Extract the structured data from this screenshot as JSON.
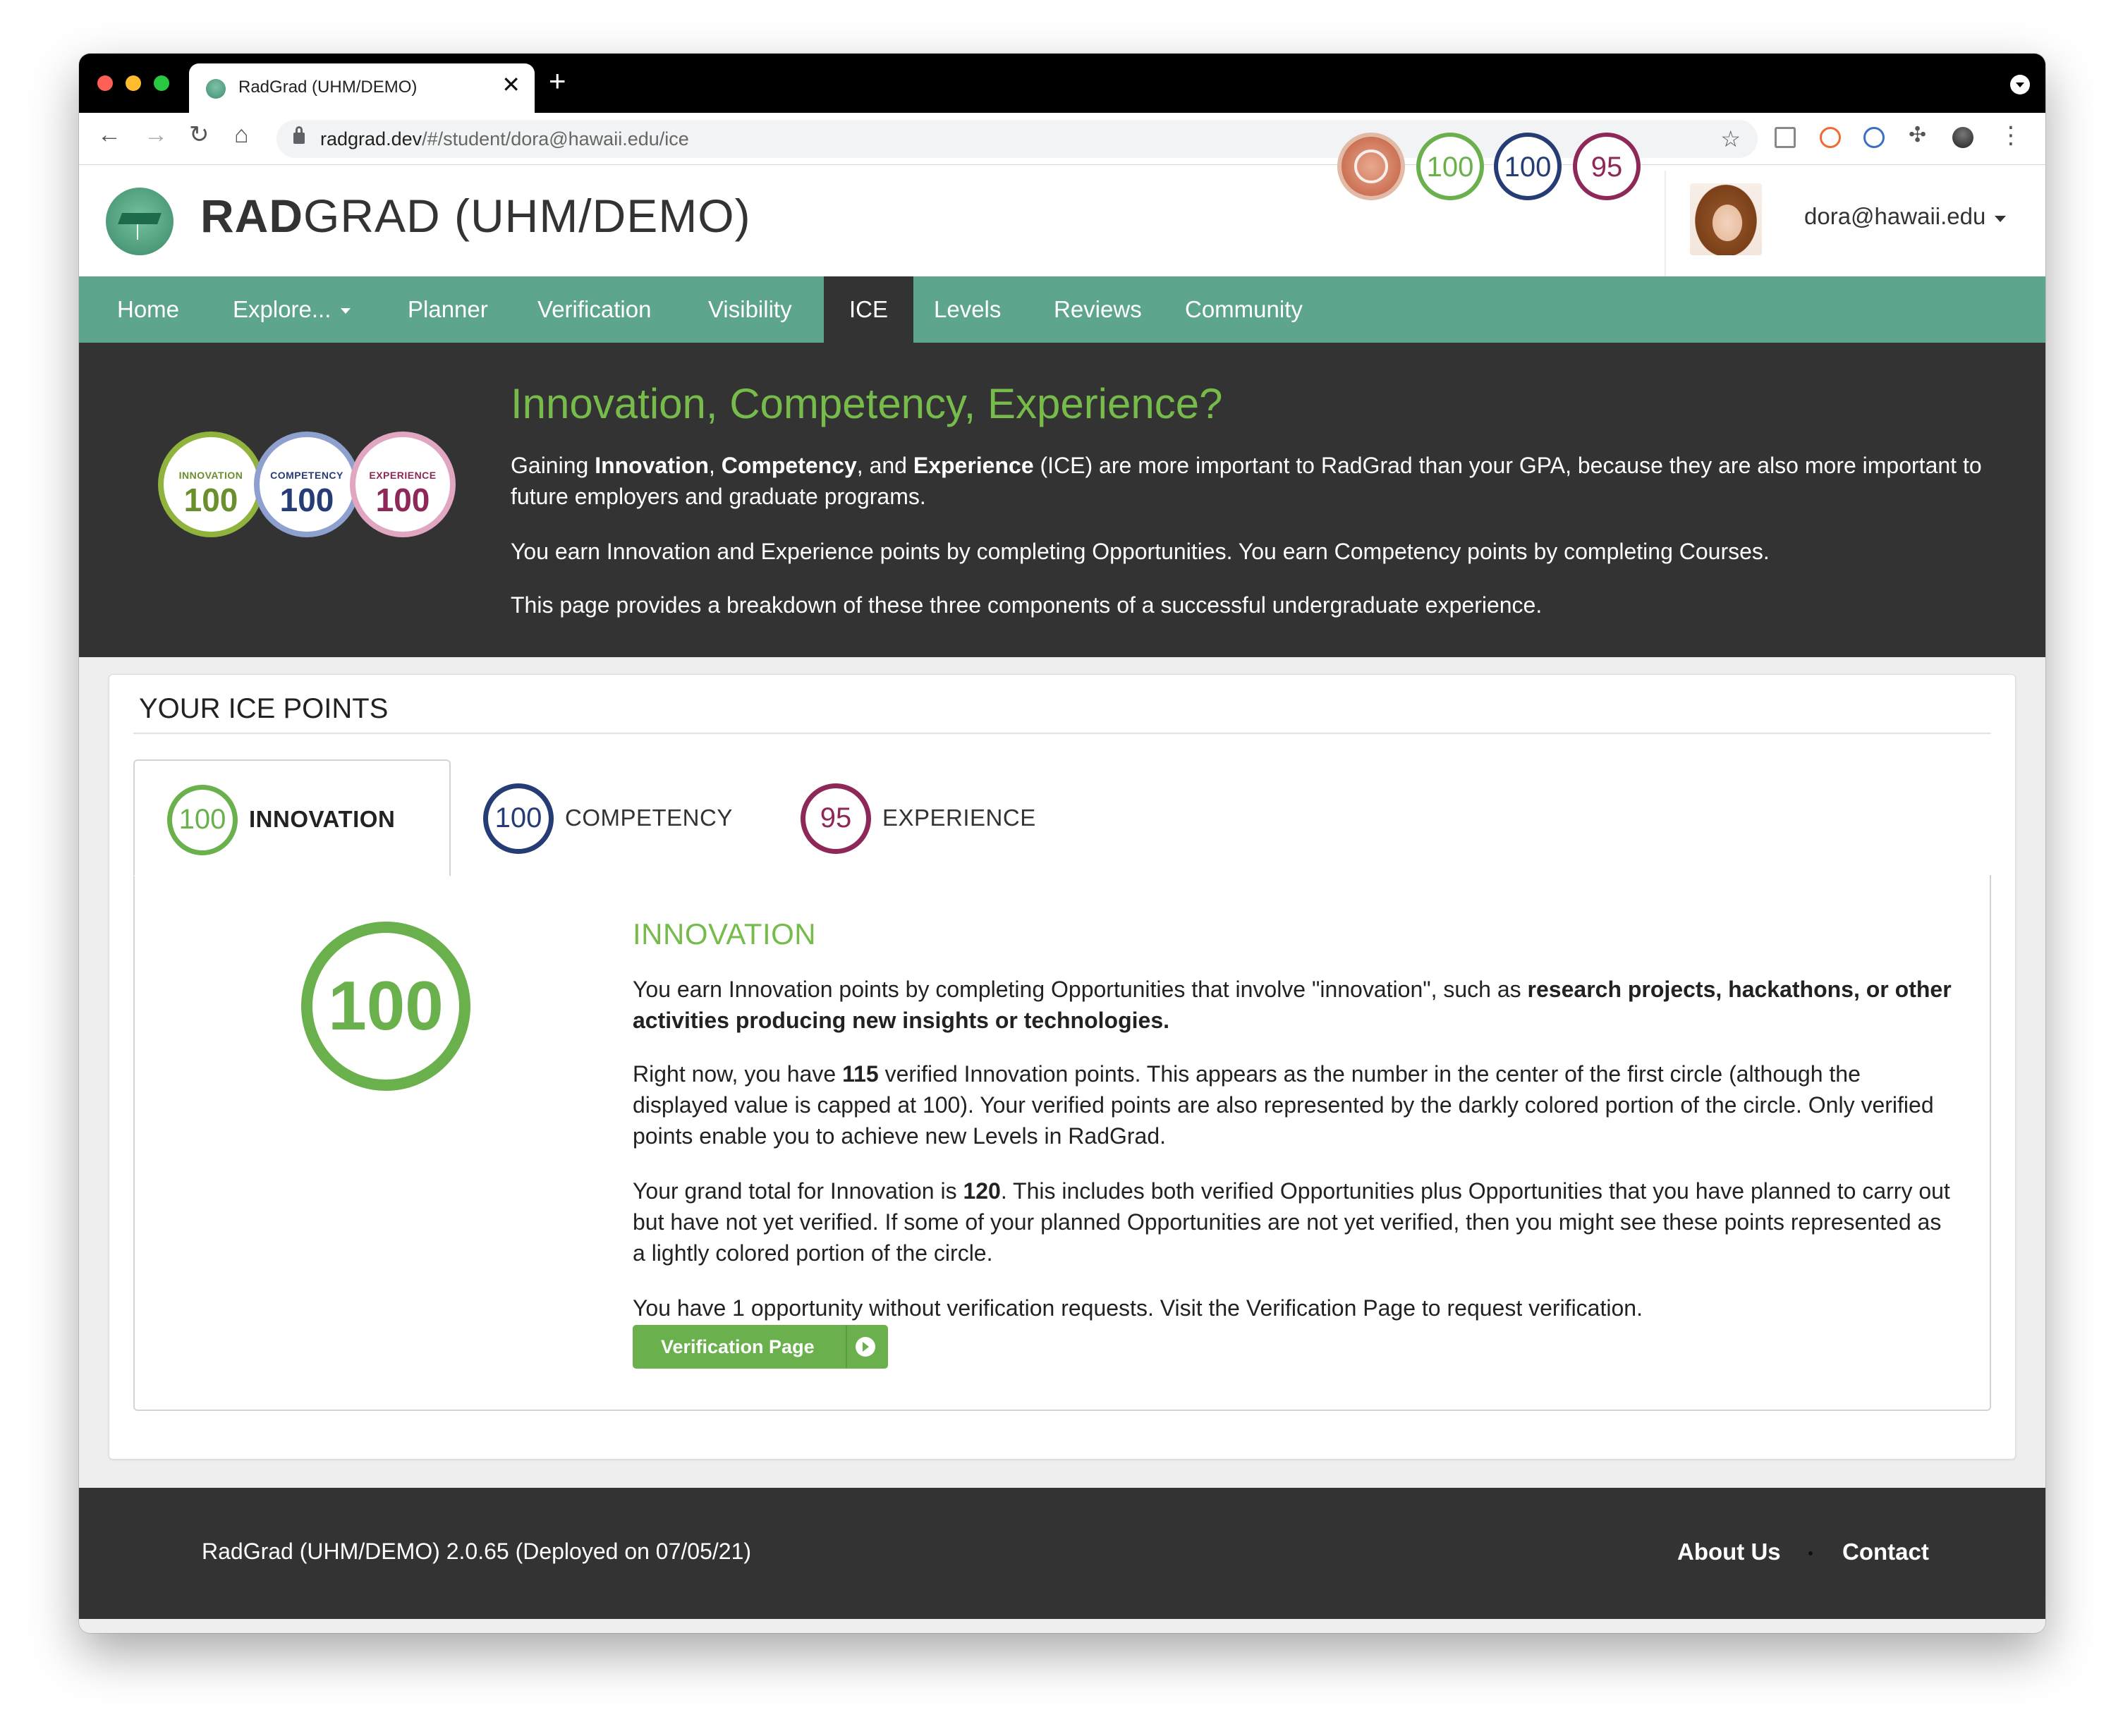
{
  "browser": {
    "tab_title": "RadGrad (UHM/DEMO)",
    "close_glyph": "✕",
    "new_tab_glyph": "+",
    "url_host": "radgrad.dev",
    "url_path": "/#/student/dora@hawaii.edu/ice",
    "back_glyph": "←",
    "forward_glyph": "→",
    "reload_glyph": "↻",
    "home_glyph": "⌂",
    "star_glyph": "☆",
    "puzzle_glyph": "✣",
    "more_glyph": "⋮"
  },
  "header": {
    "brand_bold": "RAD",
    "brand_rest": "GRAD (UHM/DEMO)",
    "innovation_points": "100",
    "competency_points": "100",
    "experience_points": "95",
    "user_email": "dora@hawaii.edu"
  },
  "nav": {
    "items": [
      {
        "label": "Home"
      },
      {
        "label": "Explore..."
      },
      {
        "label": "Planner"
      },
      {
        "label": "Verification"
      },
      {
        "label": "Visibility"
      },
      {
        "label": "ICE"
      },
      {
        "label": "Levels"
      },
      {
        "label": "Reviews"
      },
      {
        "label": "Community"
      }
    ],
    "active": "ICE"
  },
  "hero": {
    "badges": [
      {
        "label": "INNOVATION",
        "value": "100"
      },
      {
        "label": "COMPETENCY",
        "value": "100"
      },
      {
        "label": "EXPERIENCE",
        "value": "100"
      }
    ],
    "title": "Innovation, Competency, Experience?",
    "p1_a": "Gaining ",
    "p1_b": "Innovation",
    "p1_c": ", ",
    "p1_d": "Competency",
    "p1_e": ", and ",
    "p1_f": "Experience",
    "p1_g": " (ICE) are more important to RadGrad than your GPA, because they are also more important to future employers and graduate programs.",
    "p2": "You earn Innovation and Experience points by completing Opportunities. You earn Competency points by completing Courses.",
    "p3": "This page provides a breakdown of these three components of a successful undergraduate experience."
  },
  "ice_card": {
    "title": "YOUR ICE POINTS",
    "tabs": [
      {
        "value": "100",
        "label": "INNOVATION"
      },
      {
        "value": "100",
        "label": "COMPETENCY"
      },
      {
        "value": "95",
        "label": "EXPERIENCE"
      }
    ],
    "big_value": "100",
    "detail_title": "INNOVATION",
    "d1_a": "You earn Innovation points by completing Opportunities that involve \"innovation\", such as ",
    "d1_b": "research projects, hackathons, or other activities producing new insights or technologies.",
    "d2_a": "Right now, you have ",
    "d2_b": "115",
    "d2_c": " verified Innovation points. This appears as the number in the center of the first circle (although the displayed value is capped at 100). Your verified points are also represented by the darkly colored portion of the circle. Only verified points enable you to achieve new Levels in RadGrad.",
    "d3_a": "Your grand total for Innovation is ",
    "d3_b": "120",
    "d3_c": ". This includes both verified Opportunities plus Opportunities that you have planned to carry out but have not yet verified. If some of your planned Opportunities are not yet verified, then you might see these points represented as a lightly colored portion of the circle.",
    "d4": "You have 1 opportunity without verification requests. Visit the Verification Page to request verification.",
    "button_label": "Verification Page"
  },
  "footer": {
    "left": "RadGrad (UHM/DEMO) 2.0.65 (Deployed on 07/05/21)",
    "about": "About Us",
    "contact": "Contact"
  },
  "colors": {
    "innovation": "#6ab04c",
    "competency": "#263c75",
    "experience": "#8e2858",
    "nav_green": "#5ea58d",
    "dark": "#333333"
  }
}
